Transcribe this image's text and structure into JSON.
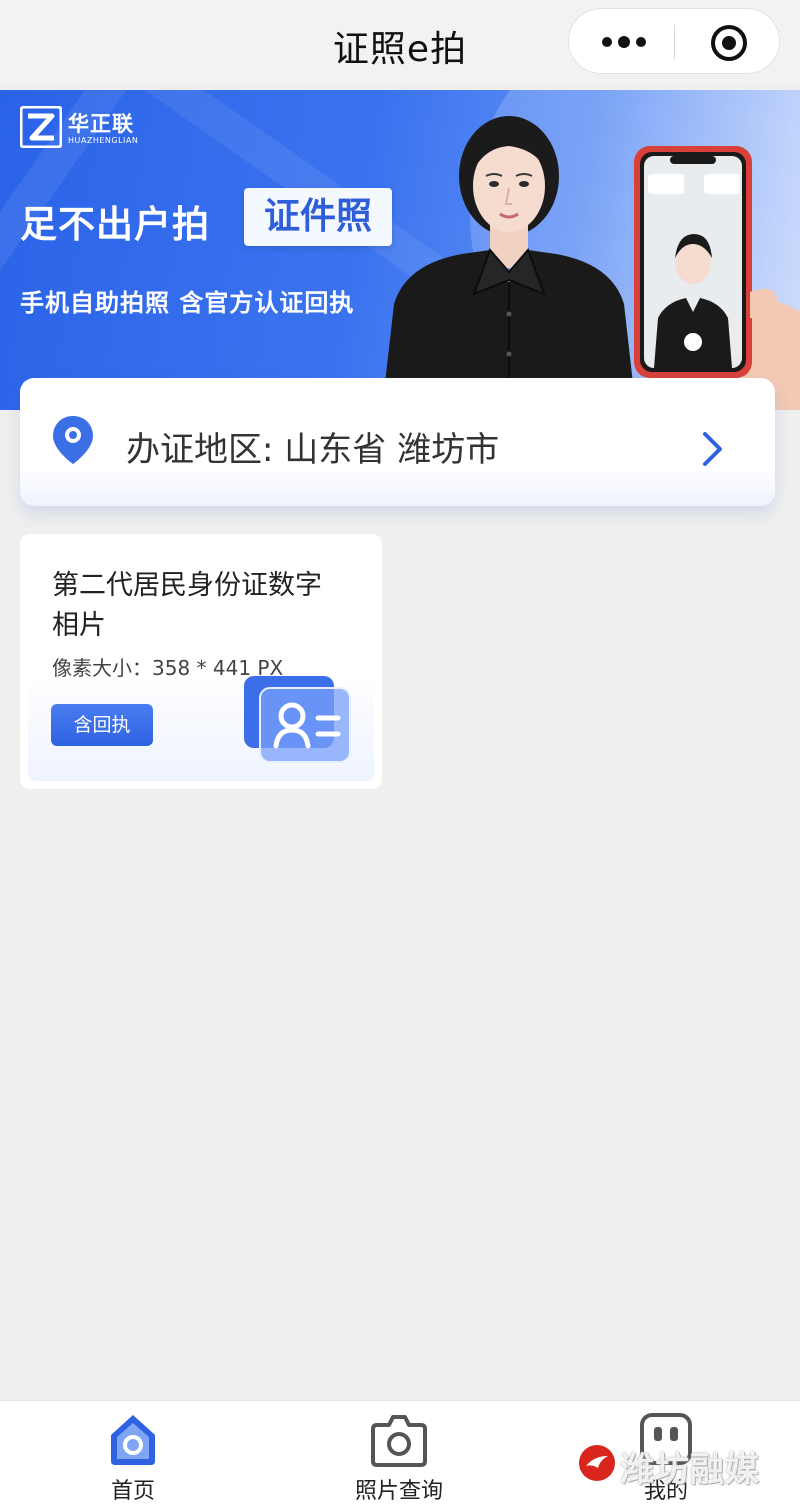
{
  "nav": {
    "title": "证照e拍"
  },
  "banner": {
    "brand_cn": "华正联",
    "brand_en": "HUAZHENGLIAN",
    "slogan_main": "足不出户拍",
    "slogan_tag": "证件照",
    "slogan_sub": "手机自助拍照  含官方认证回执"
  },
  "region": {
    "label": "办证地区: 山东省 潍坊市"
  },
  "products": [
    {
      "name": "第二代居民身份证数字相片",
      "spec": "像素大小：358 * 441 PX",
      "badge": "含回执"
    }
  ],
  "tabbar": {
    "home": "首页",
    "photo_query": "照片查询",
    "mine": "我的"
  },
  "watermark": {
    "text": "潍坊融媒"
  },
  "colors": {
    "brand_blue": "#2f62e1",
    "background": "#efefef"
  }
}
